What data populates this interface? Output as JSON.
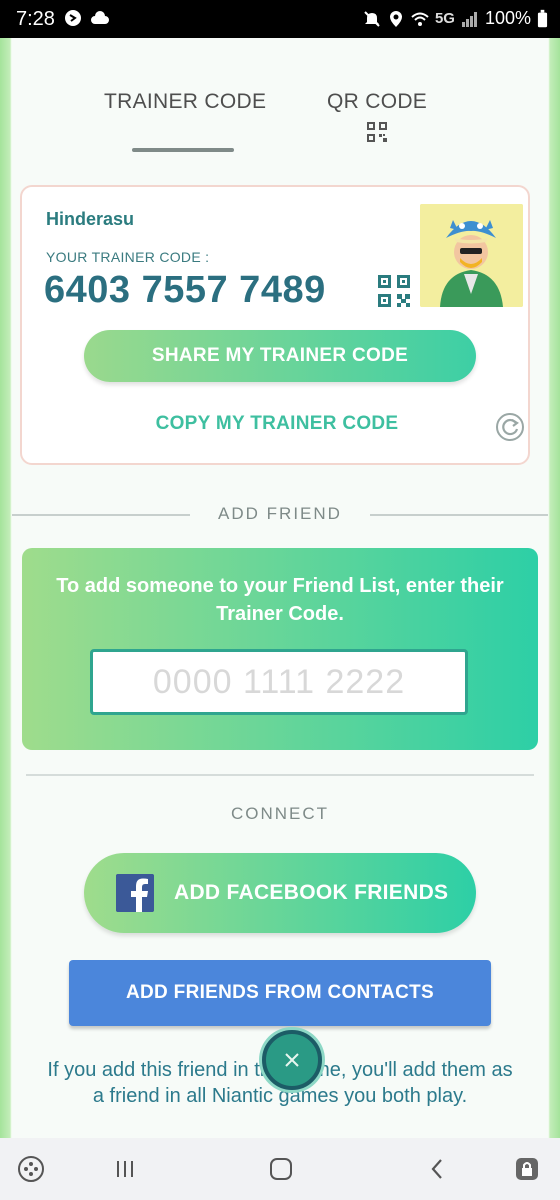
{
  "status_bar": {
    "time": "7:28",
    "network": "5G",
    "battery": "100%"
  },
  "tabs": {
    "trainer_code": "TRAINER CODE",
    "qr_code": "QR CODE"
  },
  "profile": {
    "username": "Hinderasu",
    "code_label": "YOUR TRAINER CODE :",
    "code": "6403 7557 7489"
  },
  "actions": {
    "share": "SHARE MY TRAINER CODE",
    "copy": "COPY MY TRAINER CODE"
  },
  "add_friend": {
    "title": "ADD FRIEND",
    "prompt": "To add someone to your Friend List, enter their Trainer Code.",
    "input_placeholder": "0000 1111 2222"
  },
  "connect": {
    "title": "CONNECT",
    "facebook": "ADD FACEBOOK FRIENDS",
    "contacts": "ADD FRIENDS FROM CONTACTS",
    "footnote": "If you add this friend in this game, you'll add them as a friend in all Niantic games you both play."
  },
  "icons": {
    "status_left": [
      "shazam-icon",
      "cloud-icon"
    ],
    "status_right": [
      "mute-icon",
      "location-icon",
      "wifi-icon",
      "signal-icon"
    ],
    "qr": "qr-code-icon",
    "refresh": "refresh-icon",
    "facebook": "facebook-icon",
    "close": "close-icon",
    "nav": [
      "game-launcher-icon",
      "recent-apps-icon",
      "home-icon",
      "back-icon",
      "lock-icon"
    ]
  },
  "colors": {
    "accent_green": "#3dcfa5",
    "code_text": "#2b6f80",
    "contacts_blue": "#4b86db",
    "facebook_blue": "#3b5998"
  }
}
